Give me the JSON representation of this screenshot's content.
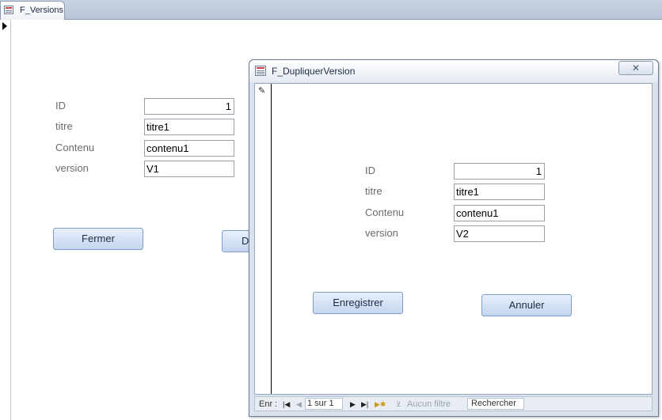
{
  "main_form": {
    "tab_title": "F_Versions",
    "fields": [
      {
        "label": "ID",
        "value": "1"
      },
      {
        "label": "titre",
        "value": "titre1"
      },
      {
        "label": "Contenu",
        "value": "contenu1"
      },
      {
        "label": "version",
        "value": "V1"
      }
    ],
    "buttons": {
      "close_label": "Fermer",
      "duplicate_label": "D"
    }
  },
  "dialog": {
    "title": "F_DupliquerVersion",
    "close_glyph": "✕",
    "fields": [
      {
        "label": "ID",
        "value": "1"
      },
      {
        "label": "titre",
        "value": "titre1"
      },
      {
        "label": "Contenu",
        "value": "contenu1"
      },
      {
        "label": "version",
        "value": "V2"
      }
    ],
    "buttons": {
      "save_label": "Enregistrer",
      "cancel_label": "Annuler"
    },
    "navbar": {
      "record_label": "Enr :",
      "record_position": "1 sur 1",
      "filter_label": "Aucun filtre",
      "search_label": "Rechercher"
    }
  },
  "icons": {
    "form_icon": "form-icon",
    "record_selector": "current-record-arrow-icon",
    "edit_pencil": "pencil-icon"
  }
}
